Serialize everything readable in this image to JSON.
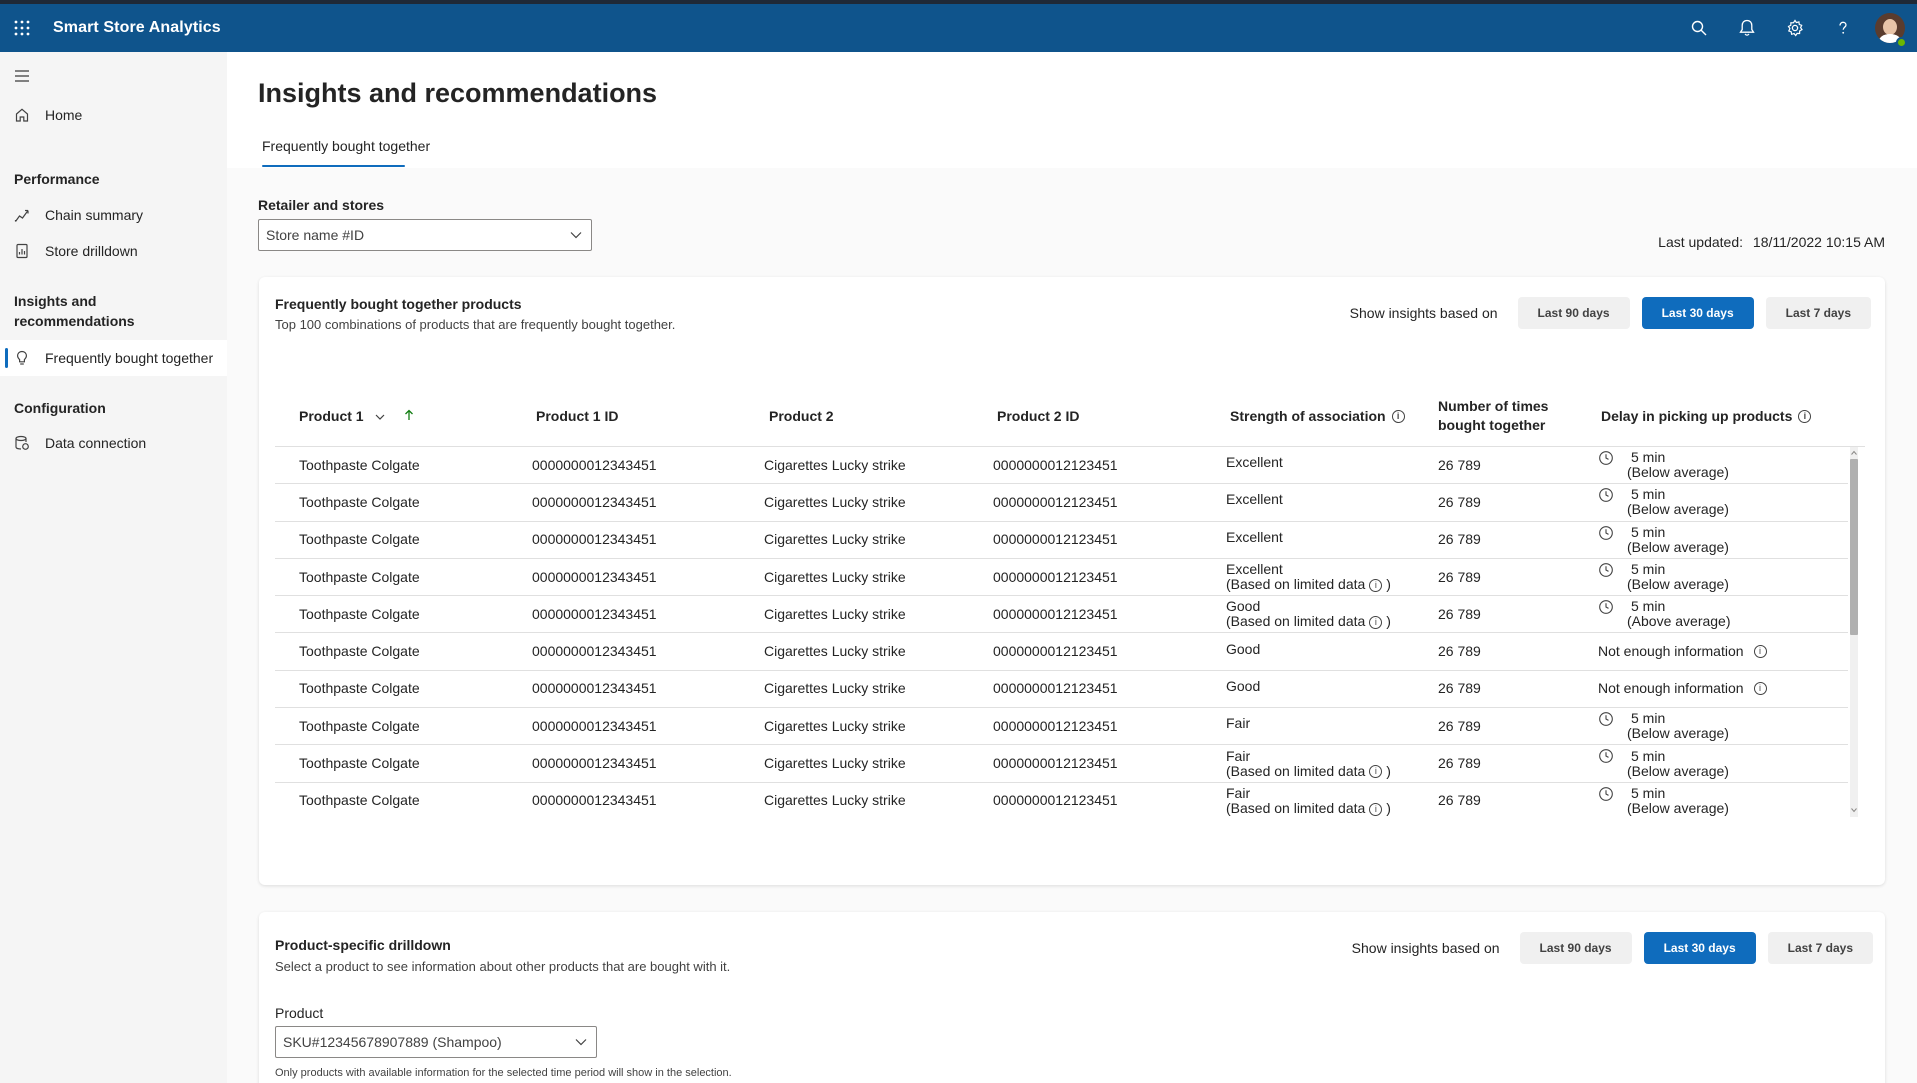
{
  "app": {
    "title": "Smart Store Analytics"
  },
  "topbar": {
    "icons": [
      "search-icon",
      "bell-icon",
      "gear-icon",
      "help-icon"
    ],
    "brand_color": "#0f548c"
  },
  "sidebar": {
    "home": "Home",
    "performance_heading": "Performance",
    "chain_summary": "Chain summary",
    "store_drilldown": "Store drilldown",
    "insights_heading_1": "Insights and",
    "insights_heading_2": "recommendations",
    "frequently_bought": "Frequently bought together",
    "configuration_heading": "Configuration",
    "data_connection": "Data connection"
  },
  "page": {
    "title": "Insights and recommendations",
    "tab": "Frequently bought together",
    "retailer_label": "Retailer and stores",
    "store_placeholder": "Store name #ID",
    "last_updated_label": "Last updated:",
    "last_updated_value": "18/11/2022 10:15 AM"
  },
  "fbt_card": {
    "title": "Frequently bought together products",
    "subtitle": "Top 100 combinations of products that are frequently bought together.",
    "show_label": "Show insights based on",
    "ranges": [
      "Last 90 days",
      "Last 30 days",
      "Last 7 days"
    ],
    "active_range": "Last 30 days",
    "columns": {
      "product1": "Product 1",
      "product1_id": "Product 1 ID",
      "product2": "Product 2",
      "product2_id": "Product 2 ID",
      "strength": "Strength of association",
      "times_1": "Number of times",
      "times_2": "bought together",
      "delay": "Delay in picking up products"
    },
    "rows": [
      {
        "p1": "Toothpaste Colgate",
        "p1id": "0000000012343451",
        "p2": "Cigarettes Lucky strike",
        "p2id": "0000000012123451",
        "strength": "Excellent",
        "limited": "",
        "times": "26 789",
        "delay": "5 min",
        "delay_note": "(Below average)"
      },
      {
        "p1": "Toothpaste Colgate",
        "p1id": "0000000012343451",
        "p2": "Cigarettes Lucky strike",
        "p2id": "0000000012123451",
        "strength": "Excellent",
        "limited": "",
        "times": "26 789",
        "delay": "5 min",
        "delay_note": "(Below average)"
      },
      {
        "p1": "Toothpaste Colgate",
        "p1id": "0000000012343451",
        "p2": "Cigarettes Lucky strike",
        "p2id": "0000000012123451",
        "strength": "Excellent",
        "limited": "",
        "times": "26 789",
        "delay": "5 min",
        "delay_note": "(Below average)"
      },
      {
        "p1": "Toothpaste Colgate",
        "p1id": "0000000012343451",
        "p2": "Cigarettes Lucky strike",
        "p2id": "0000000012123451",
        "strength": "Excellent",
        "limited": "(Based on limited data",
        "times": "26 789",
        "delay": "5 min",
        "delay_note": "(Below average)"
      },
      {
        "p1": "Toothpaste Colgate",
        "p1id": "0000000012343451",
        "p2": "Cigarettes Lucky strike",
        "p2id": "0000000012123451",
        "strength": "Good",
        "limited": "(Based on limited data",
        "times": "26 789",
        "delay": "5 min",
        "delay_note": "(Above average)"
      },
      {
        "p1": "Toothpaste Colgate",
        "p1id": "0000000012343451",
        "p2": "Cigarettes Lucky strike",
        "p2id": "0000000012123451",
        "strength": "Good",
        "limited": "",
        "times": "26 789",
        "delay": "Not enough information",
        "delay_note": ""
      },
      {
        "p1": "Toothpaste Colgate",
        "p1id": "0000000012343451",
        "p2": "Cigarettes Lucky strike",
        "p2id": "0000000012123451",
        "strength": "Good",
        "limited": "",
        "times": "26 789",
        "delay": "Not enough information",
        "delay_note": ""
      },
      {
        "p1": "Toothpaste Colgate",
        "p1id": "0000000012343451",
        "p2": "Cigarettes Lucky strike",
        "p2id": "0000000012123451",
        "strength": "Fair",
        "limited": "",
        "times": "26 789",
        "delay": "5 min",
        "delay_note": "(Below average)"
      },
      {
        "p1": "Toothpaste Colgate",
        "p1id": "0000000012343451",
        "p2": "Cigarettes Lucky strike",
        "p2id": "0000000012123451",
        "strength": "Fair",
        "limited": "(Based on limited data",
        "times": "26 789",
        "delay": "5 min",
        "delay_note": "(Below average)"
      },
      {
        "p1": "Toothpaste Colgate",
        "p1id": "0000000012343451",
        "p2": "Cigarettes Lucky strike",
        "p2id": "0000000012123451",
        "strength": "Fair",
        "limited": "(Based on limited data",
        "times": "26 789",
        "delay": "5 min",
        "delay_note": "(Below average)"
      }
    ]
  },
  "drilldown_card": {
    "title": "Product-specific drilldown",
    "subtitle": "Select a product to see information about other products that are bought with it.",
    "show_label": "Show insights based on",
    "ranges": [
      "Last 90 days",
      "Last 30 days",
      "Last 7 days"
    ],
    "active_range": "Last 30 days",
    "product_label": "Product",
    "product_value": "SKU#12345678907889 (Shampoo)",
    "note": "Only products with available information for the selected time period will show in the selection."
  }
}
